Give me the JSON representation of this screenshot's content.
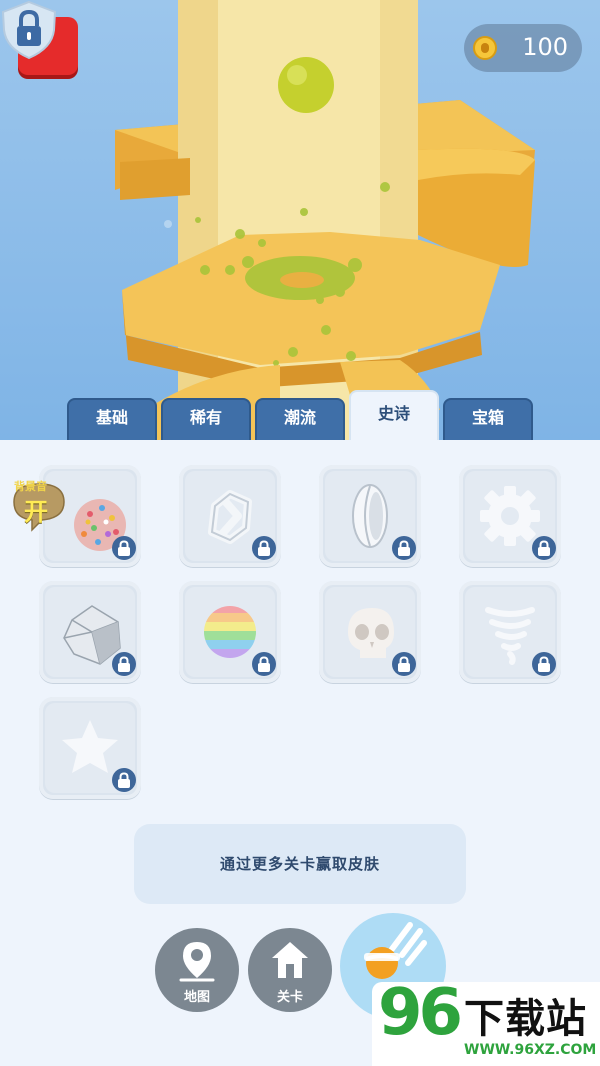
{
  "hud": {
    "coin_count": "100",
    "coin_icon": "coin-icon",
    "close_icon": "close-icon"
  },
  "tabs": [
    {
      "label": "基础",
      "active": false
    },
    {
      "label": "稀有",
      "active": false
    },
    {
      "label": "潮流",
      "active": false
    },
    {
      "label": "史诗",
      "active": true
    },
    {
      "label": "宝箱",
      "active": false
    }
  ],
  "bubble": {
    "small_text": "背景音",
    "big_text": "开"
  },
  "skins": [
    {
      "icon": "candy-ball-icon",
      "locked": true
    },
    {
      "icon": "geometric-knot-icon",
      "locked": true
    },
    {
      "icon": "rugby-ball-icon",
      "locked": true
    },
    {
      "icon": "gear-icon",
      "locked": true
    },
    {
      "icon": "polyhedron-icon",
      "locked": true
    },
    {
      "icon": "rainbow-ball-icon",
      "locked": true
    },
    {
      "icon": "skull-icon",
      "locked": true
    },
    {
      "icon": "tornado-icon",
      "locked": true
    },
    {
      "icon": "star-icon",
      "locked": true
    }
  ],
  "hint": "通过更多关卡赢取皮肤",
  "nav": [
    {
      "label": "地图",
      "icon": "map-pin-icon"
    },
    {
      "label": "关卡",
      "icon": "home-icon"
    },
    {
      "label": "",
      "icon": "helix-ball-icon",
      "active": true
    }
  ],
  "watermark": {
    "number": "96",
    "title": "下载站",
    "url": "WWW.96XZ.COM"
  },
  "colors": {
    "sky": "#8ebde9",
    "tower": "#f5e3a3",
    "platform": "#f0bd4a",
    "ball": "#c8d234",
    "tab": "#3f6fa8",
    "lock_badge": "#3e6699",
    "close": "#e52b2b"
  }
}
